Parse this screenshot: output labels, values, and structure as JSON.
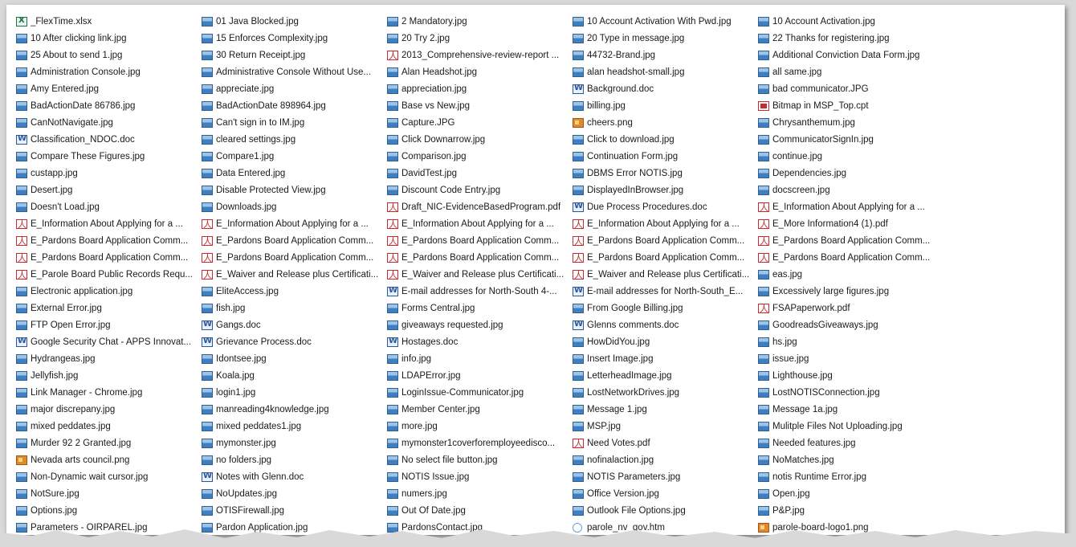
{
  "files": [
    {
      "name": "_FlexTime.xlsx",
      "icon": "xlsx-icon",
      "type": "xlsx"
    },
    {
      "name": "01 Java Blocked.jpg",
      "icon": "image-icon",
      "type": "jpg"
    },
    {
      "name": "2 Mandatory.jpg",
      "icon": "image-icon",
      "type": "jpg"
    },
    {
      "name": "10 Account Activation With Pwd.jpg",
      "icon": "image-icon",
      "type": "jpg"
    },
    {
      "name": "10 Account Activation.jpg",
      "icon": "image-icon",
      "type": "jpg"
    },
    {
      "name": "10 After clicking link.jpg",
      "icon": "image-icon",
      "type": "jpg"
    },
    {
      "name": "15 Enforces Complexity.jpg",
      "icon": "image-icon",
      "type": "jpg"
    },
    {
      "name": "20 Try 2.jpg",
      "icon": "image-icon",
      "type": "jpg"
    },
    {
      "name": "20 Type in message.jpg",
      "icon": "image-icon",
      "type": "jpg"
    },
    {
      "name": "22 Thanks for registering.jpg",
      "icon": "image-icon",
      "type": "jpg"
    },
    {
      "name": "25 About to send 1.jpg",
      "icon": "image-icon",
      "type": "jpg"
    },
    {
      "name": "30 Return Receipt.jpg",
      "icon": "image-icon",
      "type": "jpg"
    },
    {
      "name": "2013_Comprehensive-review-report ...",
      "icon": "pdf-icon",
      "type": "pdf"
    },
    {
      "name": "44732-Brand.jpg",
      "icon": "image-icon",
      "type": "jpg"
    },
    {
      "name": "Additional Conviction Data Form.jpg",
      "icon": "image-icon",
      "type": "jpg"
    },
    {
      "name": "Administration Console.jpg",
      "icon": "image-icon",
      "type": "jpg"
    },
    {
      "name": "Administrative Console Without Use...",
      "icon": "image-icon",
      "type": "jpg"
    },
    {
      "name": "Alan Headshot.jpg",
      "icon": "image-icon",
      "type": "jpg"
    },
    {
      "name": "alan headshot-small.jpg",
      "icon": "image-icon",
      "type": "jpg"
    },
    {
      "name": "all same.jpg",
      "icon": "image-icon",
      "type": "jpg"
    },
    {
      "name": "Amy Entered.jpg",
      "icon": "image-icon",
      "type": "jpg"
    },
    {
      "name": "appreciate.jpg",
      "icon": "image-icon",
      "type": "jpg"
    },
    {
      "name": "appreciation.jpg",
      "icon": "image-icon",
      "type": "jpg"
    },
    {
      "name": "Background.doc",
      "icon": "word-doc-icon",
      "type": "doc"
    },
    {
      "name": "bad communicator.JPG",
      "icon": "image-icon",
      "type": "jpg"
    },
    {
      "name": "BadActionDate 86786.jpg",
      "icon": "image-icon",
      "type": "jpg"
    },
    {
      "name": "BadActionDate 898964.jpg",
      "icon": "image-icon",
      "type": "jpg"
    },
    {
      "name": "Base vs New.jpg",
      "icon": "image-icon",
      "type": "jpg"
    },
    {
      "name": "billing.jpg",
      "icon": "image-icon",
      "type": "jpg"
    },
    {
      "name": "Bitmap in MSP_Top.cpt",
      "icon": "cpt-icon",
      "type": "cpt"
    },
    {
      "name": "CanNotNavigate.jpg",
      "icon": "image-icon",
      "type": "jpg"
    },
    {
      "name": "Can't sign in to IM.jpg",
      "icon": "image-icon",
      "type": "jpg"
    },
    {
      "name": "Capture.JPG",
      "icon": "image-icon",
      "type": "jpg"
    },
    {
      "name": "cheers.png",
      "icon": "png-icon",
      "type": "png"
    },
    {
      "name": "Chrysanthemum.jpg",
      "icon": "image-icon",
      "type": "jpg"
    },
    {
      "name": "Classification_NDOC.doc",
      "icon": "word-doc-icon",
      "type": "doc"
    },
    {
      "name": "cleared settings.jpg",
      "icon": "image-icon",
      "type": "jpg"
    },
    {
      "name": "Click Downarrow.jpg",
      "icon": "image-icon",
      "type": "jpg"
    },
    {
      "name": "Click to download.jpg",
      "icon": "image-icon",
      "type": "jpg"
    },
    {
      "name": "CommunicatorSignIn.jpg",
      "icon": "image-icon",
      "type": "jpg"
    },
    {
      "name": "Compare These Figures.jpg",
      "icon": "image-icon",
      "type": "jpg"
    },
    {
      "name": "Compare1.jpg",
      "icon": "image-icon",
      "type": "jpg"
    },
    {
      "name": "Comparison.jpg",
      "icon": "image-icon",
      "type": "jpg"
    },
    {
      "name": "Continuation Form.jpg",
      "icon": "image-icon",
      "type": "jpg"
    },
    {
      "name": "continue.jpg",
      "icon": "image-icon",
      "type": "jpg"
    },
    {
      "name": "custapp.jpg",
      "icon": "image-icon",
      "type": "jpg"
    },
    {
      "name": "Data Entered.jpg",
      "icon": "image-icon",
      "type": "jpg"
    },
    {
      "name": "DavidTest.jpg",
      "icon": "image-icon",
      "type": "jpg"
    },
    {
      "name": "DBMS Error NOTIS.jpg",
      "icon": "image-icon",
      "type": "jpg"
    },
    {
      "name": "Dependencies.jpg",
      "icon": "image-icon",
      "type": "jpg"
    },
    {
      "name": "Desert.jpg",
      "icon": "image-icon",
      "type": "jpg"
    },
    {
      "name": "Disable Protected View.jpg",
      "icon": "image-icon",
      "type": "jpg"
    },
    {
      "name": "Discount Code Entry.jpg",
      "icon": "image-icon",
      "type": "jpg"
    },
    {
      "name": "DisplayedInBrowser.jpg",
      "icon": "image-icon",
      "type": "jpg"
    },
    {
      "name": "docscreen.jpg",
      "icon": "image-icon",
      "type": "jpg"
    },
    {
      "name": "Doesn't Load.jpg",
      "icon": "image-icon",
      "type": "jpg"
    },
    {
      "name": "Downloads.jpg",
      "icon": "image-icon",
      "type": "jpg"
    },
    {
      "name": "Draft_NIC-EvidenceBasedProgram.pdf",
      "icon": "pdf-icon",
      "type": "pdf"
    },
    {
      "name": "Due Process Procedures.doc",
      "icon": "word-doc-icon",
      "type": "doc"
    },
    {
      "name": "E_Information About Applying for a ...",
      "icon": "pdf-icon",
      "type": "pdf"
    },
    {
      "name": "E_Information About Applying for a ...",
      "icon": "pdf-icon",
      "type": "pdf"
    },
    {
      "name": "E_Information About Applying for a ...",
      "icon": "pdf-icon",
      "type": "pdf"
    },
    {
      "name": "E_Information About Applying for a ...",
      "icon": "pdf-icon",
      "type": "pdf"
    },
    {
      "name": "E_Information About Applying for a ...",
      "icon": "pdf-icon",
      "type": "pdf"
    },
    {
      "name": "E_More Information4 (1).pdf",
      "icon": "pdf-icon",
      "type": "pdf"
    },
    {
      "name": "E_Pardons Board Application Comm...",
      "icon": "pdf-icon",
      "type": "pdf"
    },
    {
      "name": "E_Pardons Board Application Comm...",
      "icon": "pdf-icon",
      "type": "pdf"
    },
    {
      "name": "E_Pardons Board Application Comm...",
      "icon": "pdf-icon",
      "type": "pdf"
    },
    {
      "name": "E_Pardons Board Application Comm...",
      "icon": "pdf-icon",
      "type": "pdf"
    },
    {
      "name": "E_Pardons Board Application Comm...",
      "icon": "pdf-icon",
      "type": "pdf"
    },
    {
      "name": "E_Pardons Board Application Comm...",
      "icon": "pdf-icon",
      "type": "pdf"
    },
    {
      "name": "E_Pardons Board Application Comm...",
      "icon": "pdf-icon",
      "type": "pdf"
    },
    {
      "name": "E_Pardons Board Application Comm...",
      "icon": "pdf-icon",
      "type": "pdf"
    },
    {
      "name": "E_Pardons Board Application Comm...",
      "icon": "pdf-icon",
      "type": "pdf"
    },
    {
      "name": "E_Pardons Board Application Comm...",
      "icon": "pdf-icon",
      "type": "pdf"
    },
    {
      "name": "E_Parole Board Public Records Requ...",
      "icon": "pdf-icon",
      "type": "pdf"
    },
    {
      "name": "E_Waiver and Release plus Certificati...",
      "icon": "pdf-icon",
      "type": "pdf"
    },
    {
      "name": "E_Waiver and Release plus Certificati...",
      "icon": "pdf-icon",
      "type": "pdf"
    },
    {
      "name": "E_Waiver and Release plus Certificati...",
      "icon": "pdf-icon",
      "type": "pdf"
    },
    {
      "name": "eas.jpg",
      "icon": "image-icon",
      "type": "jpg"
    },
    {
      "name": "Electronic application.jpg",
      "icon": "image-icon",
      "type": "jpg"
    },
    {
      "name": "EliteAccess.jpg",
      "icon": "image-icon",
      "type": "jpg"
    },
    {
      "name": "E-mail addresses for North-South 4-...",
      "icon": "word-doc-icon",
      "type": "doc"
    },
    {
      "name": "E-mail addresses for North-South_E...",
      "icon": "word-doc-icon",
      "type": "doc"
    },
    {
      "name": "Excessively large figures.jpg",
      "icon": "image-icon",
      "type": "jpg"
    },
    {
      "name": "External Error.jpg",
      "icon": "image-icon",
      "type": "jpg"
    },
    {
      "name": "fish.jpg",
      "icon": "image-icon",
      "type": "jpg"
    },
    {
      "name": "Forms Central.jpg",
      "icon": "image-icon",
      "type": "jpg"
    },
    {
      "name": "From Google Billing.jpg",
      "icon": "image-icon",
      "type": "jpg"
    },
    {
      "name": "FSAPaperwork.pdf",
      "icon": "pdf-icon",
      "type": "pdf"
    },
    {
      "name": "FTP Open Error.jpg",
      "icon": "image-icon",
      "type": "jpg"
    },
    {
      "name": "Gangs.doc",
      "icon": "word-doc-icon",
      "type": "doc"
    },
    {
      "name": "giveaways requested.jpg",
      "icon": "image-icon",
      "type": "jpg"
    },
    {
      "name": "Glenns comments.doc",
      "icon": "word-doc-icon",
      "type": "doc"
    },
    {
      "name": "GoodreadsGiveaways.jpg",
      "icon": "image-icon",
      "type": "jpg"
    },
    {
      "name": "Google Security Chat - APPS Innovat...",
      "icon": "word-doc-icon",
      "type": "doc"
    },
    {
      "name": "Grievance Process.doc",
      "icon": "word-doc-icon",
      "type": "doc"
    },
    {
      "name": "Hostages.doc",
      "icon": "word-doc-icon",
      "type": "doc"
    },
    {
      "name": "HowDidYou.jpg",
      "icon": "image-icon",
      "type": "jpg"
    },
    {
      "name": "hs.jpg",
      "icon": "image-icon",
      "type": "jpg"
    },
    {
      "name": "Hydrangeas.jpg",
      "icon": "image-icon",
      "type": "jpg"
    },
    {
      "name": "Idontsee.jpg",
      "icon": "image-icon",
      "type": "jpg"
    },
    {
      "name": "info.jpg",
      "icon": "image-icon",
      "type": "jpg"
    },
    {
      "name": "Insert Image.jpg",
      "icon": "image-icon",
      "type": "jpg"
    },
    {
      "name": "issue.jpg",
      "icon": "image-icon",
      "type": "jpg"
    },
    {
      "name": "Jellyfish.jpg",
      "icon": "image-icon",
      "type": "jpg"
    },
    {
      "name": "Koala.jpg",
      "icon": "image-icon",
      "type": "jpg"
    },
    {
      "name": "LDAPError.jpg",
      "icon": "image-icon",
      "type": "jpg"
    },
    {
      "name": "LetterheadImage.jpg",
      "icon": "image-icon",
      "type": "jpg"
    },
    {
      "name": "Lighthouse.jpg",
      "icon": "image-icon",
      "type": "jpg"
    },
    {
      "name": "Link Manager - Chrome.jpg",
      "icon": "image-icon",
      "type": "jpg"
    },
    {
      "name": "login1.jpg",
      "icon": "image-icon",
      "type": "jpg"
    },
    {
      "name": "LoginIssue-Communicator.jpg",
      "icon": "image-icon",
      "type": "jpg"
    },
    {
      "name": "LostNetworkDrives.jpg",
      "icon": "image-icon",
      "type": "jpg"
    },
    {
      "name": "LostNOTISConnection.jpg",
      "icon": "image-icon",
      "type": "jpg"
    },
    {
      "name": "major discrepany.jpg",
      "icon": "image-icon",
      "type": "jpg"
    },
    {
      "name": "manreading4knowledge.jpg",
      "icon": "image-icon",
      "type": "jpg"
    },
    {
      "name": "Member Center.jpg",
      "icon": "image-icon",
      "type": "jpg"
    },
    {
      "name": "Message 1.jpg",
      "icon": "image-icon",
      "type": "jpg"
    },
    {
      "name": "Message 1a.jpg",
      "icon": "image-icon",
      "type": "jpg"
    },
    {
      "name": "mixed peddates.jpg",
      "icon": "image-icon",
      "type": "jpg"
    },
    {
      "name": "mixed peddates1.jpg",
      "icon": "image-icon",
      "type": "jpg"
    },
    {
      "name": "more.jpg",
      "icon": "image-icon",
      "type": "jpg"
    },
    {
      "name": "MSP.jpg",
      "icon": "image-icon",
      "type": "jpg"
    },
    {
      "name": "Mulitple Files Not Uploading.jpg",
      "icon": "image-icon",
      "type": "jpg"
    },
    {
      "name": "Murder 92 2 Granted.jpg",
      "icon": "image-icon",
      "type": "jpg"
    },
    {
      "name": "mymonster.jpg",
      "icon": "image-icon",
      "type": "jpg"
    },
    {
      "name": "mymonster1coverforemployeedisco...",
      "icon": "image-icon",
      "type": "jpg"
    },
    {
      "name": "Need Votes.pdf",
      "icon": "pdf-icon",
      "type": "pdf"
    },
    {
      "name": "Needed features.jpg",
      "icon": "image-icon",
      "type": "jpg"
    },
    {
      "name": "Nevada arts council.png",
      "icon": "png-icon",
      "type": "png"
    },
    {
      "name": "no folders.jpg",
      "icon": "image-icon",
      "type": "jpg"
    },
    {
      "name": "No select file button.jpg",
      "icon": "image-icon",
      "type": "jpg"
    },
    {
      "name": "nofinalaction.jpg",
      "icon": "image-icon",
      "type": "jpg"
    },
    {
      "name": "NoMatches.jpg",
      "icon": "image-icon",
      "type": "jpg"
    },
    {
      "name": "Non-Dynamic wait cursor.jpg",
      "icon": "image-icon",
      "type": "jpg"
    },
    {
      "name": "Notes with Glenn.doc",
      "icon": "word-doc-icon",
      "type": "doc"
    },
    {
      "name": "NOTIS Issue.jpg",
      "icon": "image-icon",
      "type": "jpg"
    },
    {
      "name": "NOTIS Parameters.jpg",
      "icon": "image-icon",
      "type": "jpg"
    },
    {
      "name": "notis Runtime Error.jpg",
      "icon": "image-icon",
      "type": "jpg"
    },
    {
      "name": "NotSure.jpg",
      "icon": "image-icon",
      "type": "jpg"
    },
    {
      "name": "NoUpdates.jpg",
      "icon": "image-icon",
      "type": "jpg"
    },
    {
      "name": "numers.jpg",
      "icon": "image-icon",
      "type": "jpg"
    },
    {
      "name": "Office Version.jpg",
      "icon": "image-icon",
      "type": "jpg"
    },
    {
      "name": "Open.jpg",
      "icon": "image-icon",
      "type": "jpg"
    },
    {
      "name": "Options.jpg",
      "icon": "image-icon",
      "type": "jpg"
    },
    {
      "name": "OTISFirewall.jpg",
      "icon": "image-icon",
      "type": "jpg"
    },
    {
      "name": "Out Of Date.jpg",
      "icon": "image-icon",
      "type": "jpg"
    },
    {
      "name": "Outlook File Options.jpg",
      "icon": "image-icon",
      "type": "jpg"
    },
    {
      "name": "P&P.jpg",
      "icon": "image-icon",
      "type": "jpg"
    },
    {
      "name": "Parameters - OIRPAREL.jpg",
      "icon": "image-icon",
      "type": "jpg"
    },
    {
      "name": "Pardon Application.jpg",
      "icon": "image-icon",
      "type": "jpg"
    },
    {
      "name": "PardonsContact.jpg",
      "icon": "image-icon",
      "type": "jpg"
    },
    {
      "name": "parole_nv_gov.htm",
      "icon": "web-page-icon",
      "type": "htm"
    },
    {
      "name": "parole-board-logo1.png",
      "icon": "png-icon",
      "type": "png"
    }
  ]
}
